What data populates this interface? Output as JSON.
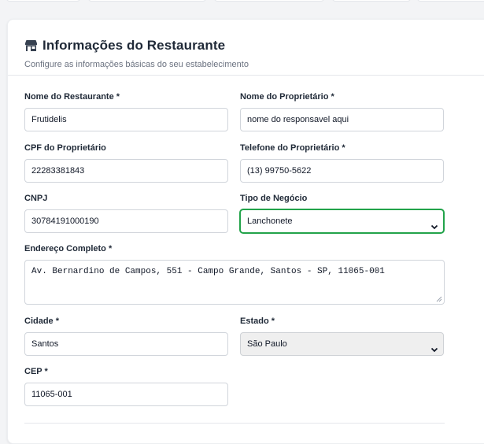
{
  "section": {
    "icon": "store-icon",
    "title": "Informações do Restaurante",
    "subtitle": "Configure as informações básicas do seu estabelecimento"
  },
  "fields": {
    "restaurant_name": {
      "label": "Nome do Restaurante *",
      "value": "Frutidelis"
    },
    "owner_name": {
      "label": "Nome do Proprietário *",
      "value": "nome do responsavel aqui"
    },
    "owner_cpf": {
      "label": "CPF do Proprietário",
      "value": "22283381843"
    },
    "owner_phone": {
      "label": "Telefone do Proprietário *",
      "value": "(13) 99750-5622"
    },
    "cnpj": {
      "label": "CNPJ",
      "value": "30784191000190"
    },
    "business_type": {
      "label": "Tipo de Negócio",
      "value": "Lanchonete"
    },
    "address": {
      "label": "Endereço Completo *",
      "value": "Av. Bernardino de Campos, 551 - Campo Grande, Santos - SP, 11065-001"
    },
    "city": {
      "label": "Cidade *",
      "value": "Santos"
    },
    "state": {
      "label": "Estado *",
      "value": "São Paulo"
    },
    "cep": {
      "label": "CEP *",
      "value": "11065-001"
    }
  },
  "colors": {
    "accent_focus": "#22a34a",
    "text": "#1f2937",
    "muted": "#6b7280"
  }
}
